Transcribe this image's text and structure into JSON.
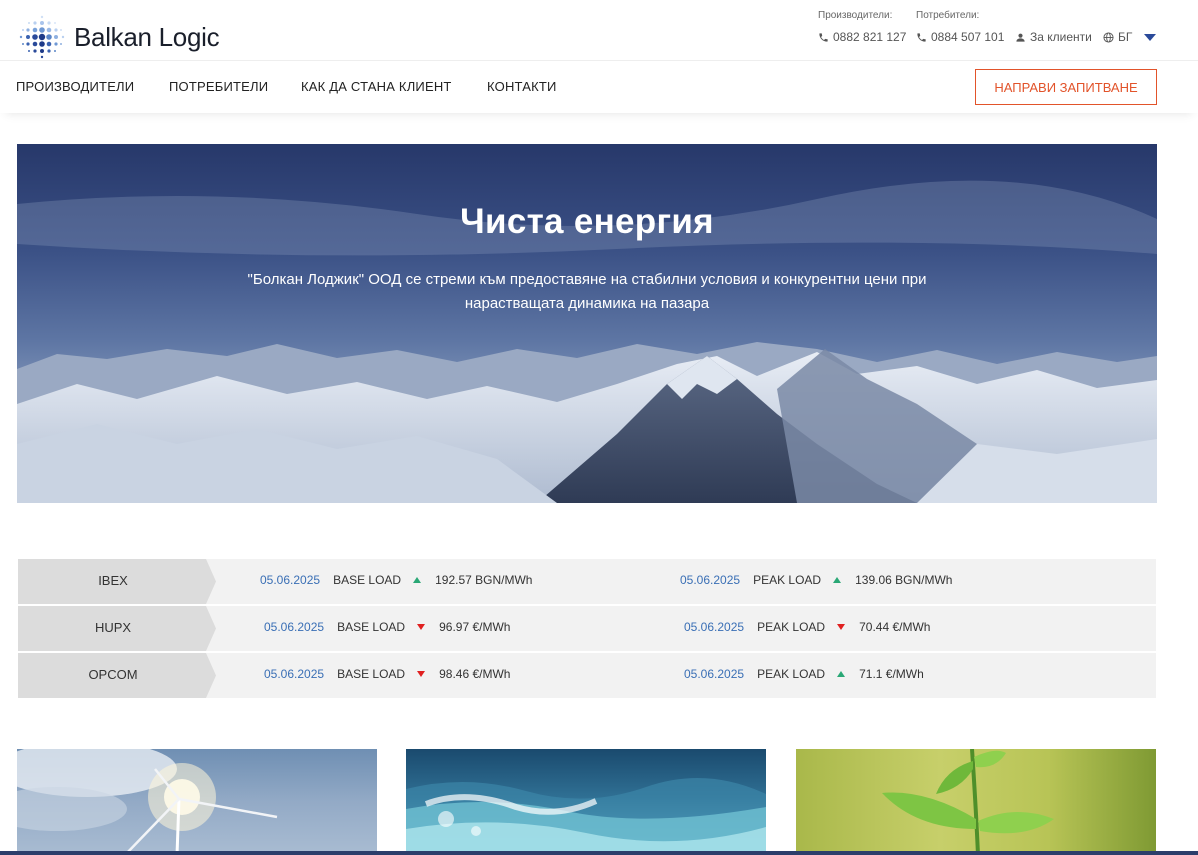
{
  "brand": {
    "name": "Balkan Logic"
  },
  "contacts": {
    "producers_label": "Производители:",
    "producers_phone": "0882 821 127",
    "consumers_label": "Потребители:",
    "consumers_phone": "0884 507 101",
    "client_link": "За клиенти",
    "language": "БГ"
  },
  "nav": {
    "producers": "ПРОИЗВОДИТЕЛИ",
    "consumers": "ПОТРЕБИТЕЛИ",
    "howto": "КАК ДА СТАНА КЛИЕНТ",
    "contacts": "КОНТАКТИ",
    "cta": "НАПРАВИ ЗАПИТВАНЕ"
  },
  "hero": {
    "title": "Чиста енергия",
    "subtitle": "\"Болкан Лоджик\" ООД се стреми към предоставяне на стабилни условия и конкурентни цени при нарастващата динамика на пазара"
  },
  "prices": [
    {
      "exchange": "IBEX",
      "base": {
        "date": "05.06.2025",
        "type": "BASE LOAD",
        "trend": "up",
        "value": "192.57 BGN/MWh"
      },
      "peak": {
        "date": "05.06.2025",
        "type": "PEAK LOAD",
        "trend": "up",
        "value": "139.06 BGN/MWh"
      }
    },
    {
      "exchange": "HUPX",
      "base": {
        "date": "05.06.2025",
        "type": "BASE LOAD",
        "trend": "down",
        "value": "96.97 €/MWh"
      },
      "peak": {
        "date": "05.06.2025",
        "type": "PEAK LOAD",
        "trend": "down",
        "value": "70.44 €/MWh"
      }
    },
    {
      "exchange": "OPCOM",
      "base": {
        "date": "05.06.2025",
        "type": "BASE LOAD",
        "trend": "down",
        "value": "98.46 €/MWh"
      },
      "peak": {
        "date": "05.06.2025",
        "type": "PEAK LOAD",
        "trend": "up",
        "value": "71.1 €/MWh"
      }
    }
  ],
  "colors": {
    "accent": "#e2532a",
    "link": "#3a6fb5",
    "trend_up": "#2aa876",
    "trend_down": "#e02020"
  }
}
